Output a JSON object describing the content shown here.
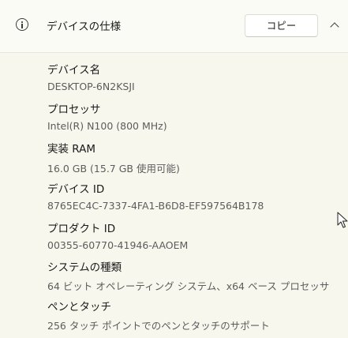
{
  "header": {
    "title": "デバイスの仕様",
    "copy_label": "コピー"
  },
  "specs": {
    "device_name": {
      "label": "デバイス名",
      "value": "DESKTOP-6N2KSJI"
    },
    "processor": {
      "label": "プロセッサ",
      "value": "Intel(R) N100 (800 MHz)"
    },
    "ram": {
      "label": "実装 RAM",
      "value": "16.0 GB (15.7 GB 使用可能)"
    },
    "device_id": {
      "label": "デバイス ID",
      "value": "8765EC4C-7337-4FA1-B6D8-EF597564B178"
    },
    "product_id": {
      "label": "プロダクト ID",
      "value": "00355-60770-41946-AAOEM"
    },
    "system_type": {
      "label": "システムの種類",
      "value": "64 ビット オペレーティング システム、x64 ベース プロセッサ"
    },
    "pen_touch": {
      "label": "ペンとタッチ",
      "value": "256 タッチ ポイントでのペンとタッチのサポート"
    }
  }
}
